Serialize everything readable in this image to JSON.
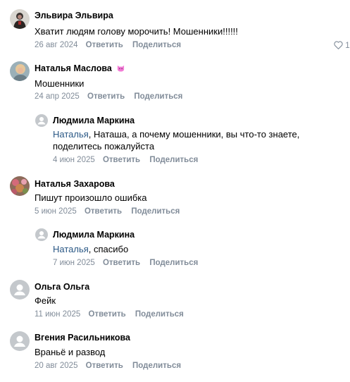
{
  "actions": {
    "reply": "Ответить",
    "share": "Поделиться"
  },
  "comments": [
    {
      "author": "Эльвира Эльвира",
      "text": "Хватит людям голову морочить! Мошенники!!!!!!",
      "date": "26 авг 2024",
      "likes": "1",
      "avatar": "photo-avatar-dark"
    },
    {
      "author": "Наталья Маслова",
      "author_emoji": "pink-cat-icon",
      "text": "Мошенники",
      "date": "24 апр 2025",
      "avatar": "photo-avatar-light"
    },
    {
      "author": "Людмила Маркина",
      "mention": "Наталья",
      "text_line1": ", Наташа, а почему мошенники, вы что-то знаете,",
      "text_line2": "поделитесь пожалуйста",
      "date": "4 июн 2025",
      "avatar": "default-user-icon"
    },
    {
      "author": "Наталья Захарова",
      "text": "Пишут произошло ошибка",
      "date": "5 июн 2025",
      "avatar": "photo-avatar-flowers"
    },
    {
      "author": "Людмила Маркина",
      "mention": "Наталья",
      "text": ", спасибо",
      "date": "7 июн 2025",
      "avatar": "default-user-icon"
    },
    {
      "author": "Ольга Ольга",
      "text": "Фейк",
      "date": "11 июн 2025",
      "avatar": "default-user-icon"
    },
    {
      "author": "Вгения Расильникова",
      "text": "Враньё и развод",
      "date": "20 авг 2025",
      "avatar": "default-user-icon"
    }
  ],
  "colors": {
    "meta": "#818c99",
    "mention": "#2a5885",
    "default_avatar_bg": "#c4c8cc"
  }
}
